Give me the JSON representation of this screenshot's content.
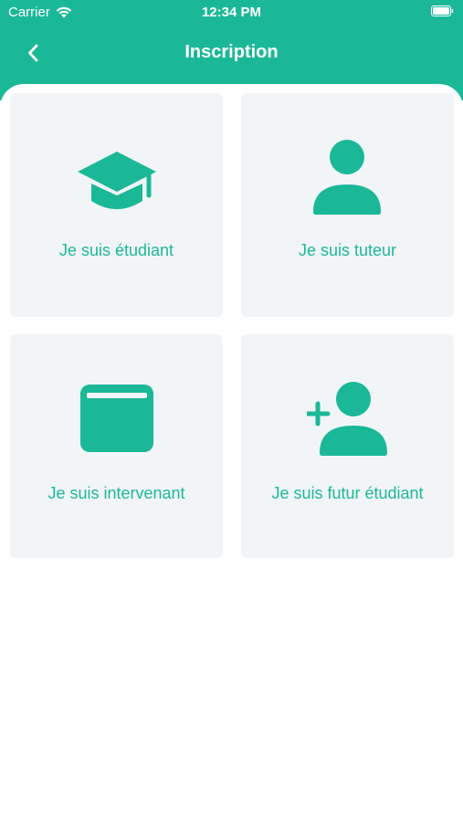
{
  "status_bar": {
    "carrier": "Carrier",
    "time": "12:34 PM",
    "wifi_icon": "wifi-icon",
    "battery_icon": "battery-icon"
  },
  "nav": {
    "title": "Inscription",
    "back_icon": "chevron-left-icon"
  },
  "colors": {
    "accent": "#1bb898",
    "card_background": "#f2f5f8",
    "background": "#ffffff"
  },
  "options": [
    {
      "label": "Je suis étudiant",
      "icon": "graduation-cap-icon"
    },
    {
      "label": "Je suis tuteur",
      "icon": "user-icon"
    },
    {
      "label": "Je suis intervenant",
      "icon": "calendar-icon"
    },
    {
      "label": "Je suis futur étudiant",
      "icon": "add-user-icon"
    }
  ]
}
